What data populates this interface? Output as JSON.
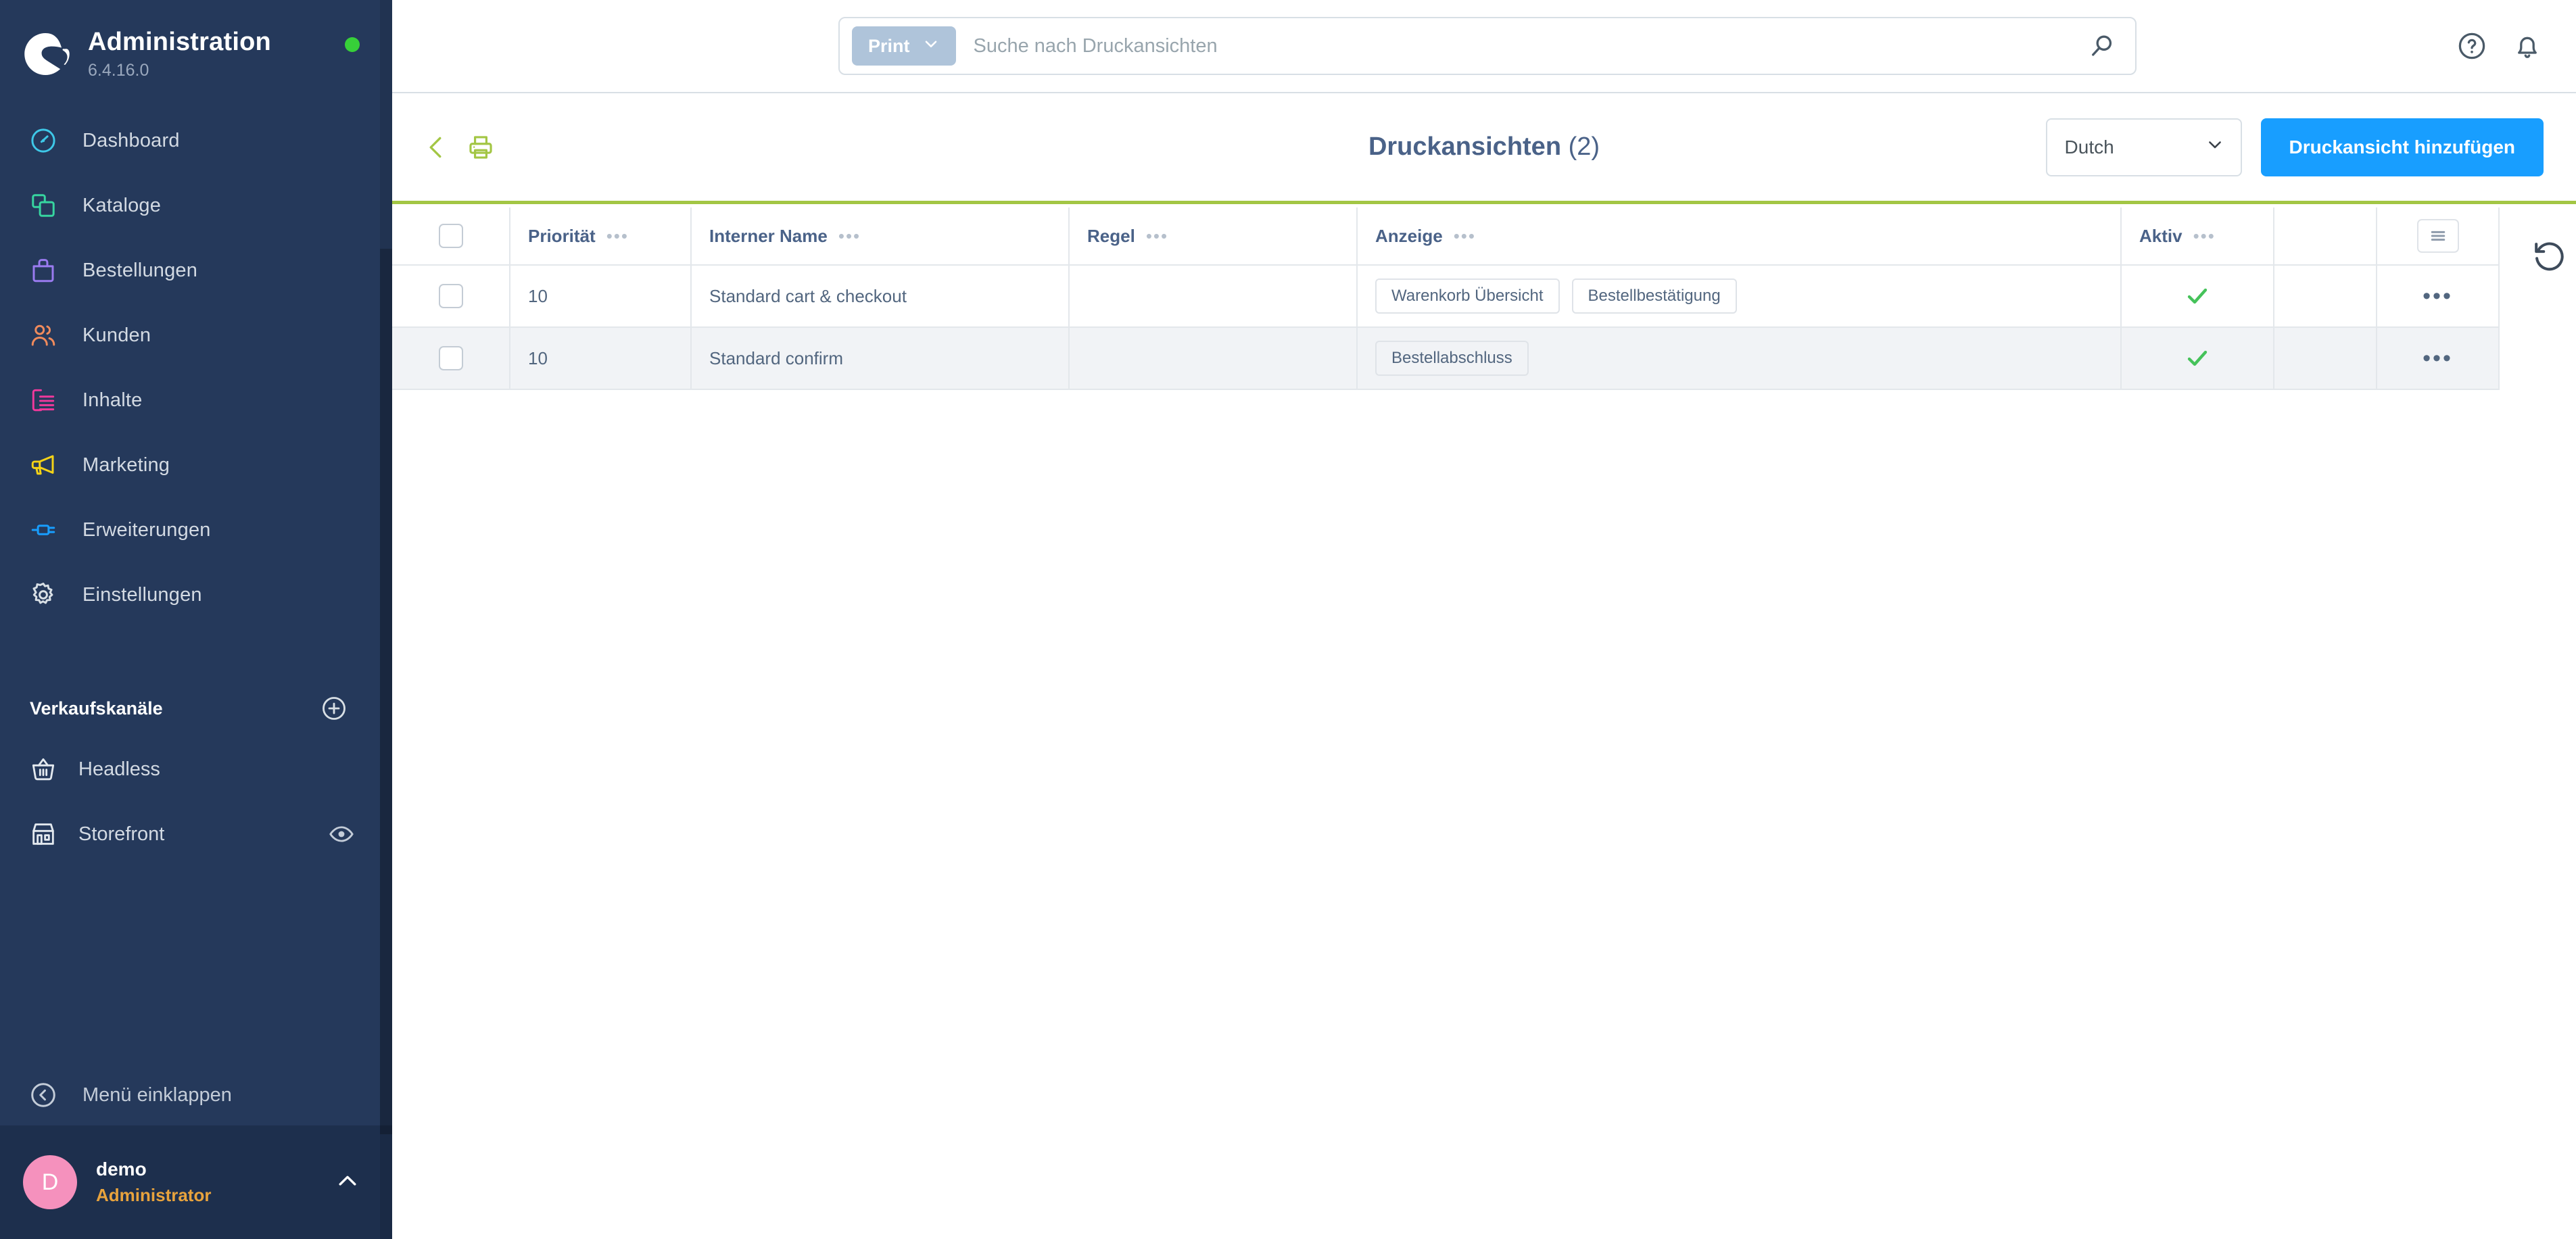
{
  "sidebar": {
    "brand": {
      "title": "Administration",
      "version": "6.4.16.0",
      "status_icon": "status-dot-green",
      "logo_icon": "shopware-logo-icon"
    },
    "nav_items": [
      {
        "label": "Dashboard",
        "icon": "dashboard-icon",
        "color": "#3ec8e8"
      },
      {
        "label": "Kataloge",
        "icon": "catalog-icon",
        "color": "#37d5a0"
      },
      {
        "label": "Bestellungen",
        "icon": "orders-bag-icon",
        "color": "#9a7bf0"
      },
      {
        "label": "Kunden",
        "icon": "customers-icon",
        "color": "#f08b5c"
      },
      {
        "label": "Inhalte",
        "icon": "content-icon",
        "color": "#f0399b"
      },
      {
        "label": "Marketing",
        "icon": "megaphone-icon",
        "color": "#f5d317"
      },
      {
        "label": "Erweiterungen",
        "icon": "plug-icon",
        "color": "#189eff"
      },
      {
        "label": "Einstellungen",
        "icon": "gear-icon",
        "color": "#d8dfe5"
      }
    ],
    "sales_channels": {
      "title": "Verkaufskanäle",
      "add_icon": "plus-circle-icon",
      "items": [
        {
          "label": "Headless",
          "icon": "basket-icon",
          "trailing_icon": ""
        },
        {
          "label": "Storefront",
          "icon": "storefront-icon",
          "trailing_icon": "eye-icon"
        }
      ]
    },
    "collapse": {
      "label": "Menü einklappen",
      "icon": "collapse-left-icon"
    },
    "user": {
      "avatar_letter": "D",
      "avatar_color": "#f591bd",
      "name": "demo",
      "role": "Administrator",
      "chevron_icon": "chevron-up-icon"
    }
  },
  "topbar": {
    "search_type_label": "Print",
    "search_type_chevron": "chevron-down-icon",
    "search_placeholder": "Suche nach Druckansichten",
    "search_value": "",
    "search_icon": "search-icon",
    "help_icon": "help-circle-icon",
    "notifications_icon": "bell-icon"
  },
  "smartbar": {
    "back_icon": "chevron-left-icon",
    "page_icon": "printer-icon",
    "title": "Druckansichten",
    "count": "(2)",
    "language_select_value": "Dutch",
    "language_select_chevron": "chevron-down-icon",
    "add_button_label": "Druckansicht hinzufügen",
    "accent_color": "#a3c644",
    "primary_color": "#189eff"
  },
  "table": {
    "select_all_checkbox": false,
    "columns_button_icon": "columns-settings-icon",
    "reset_button_icon": "reset-refresh-icon",
    "headers": [
      {
        "label": "Priorität",
        "has_menu": true
      },
      {
        "label": "Interner Name",
        "has_menu": true
      },
      {
        "label": "Regel",
        "has_menu": true
      },
      {
        "label": "Anzeige",
        "has_menu": true
      },
      {
        "label": "Aktiv",
        "has_menu": true
      }
    ],
    "header_menu_dots": "•••",
    "row_menu_dots": "•••",
    "rows": [
      {
        "checked": false,
        "prioritaet": "10",
        "interner_name": "Standard cart & checkout",
        "regel": "",
        "anzeige": [
          "Warenkorb Übersicht",
          "Bestellbestätigung"
        ],
        "aktiv": true,
        "aktiv_icon": "check-icon"
      },
      {
        "checked": false,
        "prioritaet": "10",
        "interner_name": "Standard confirm",
        "regel": "",
        "anzeige": [
          "Bestellabschluss"
        ],
        "aktiv": true,
        "aktiv_icon": "check-icon"
      }
    ]
  }
}
